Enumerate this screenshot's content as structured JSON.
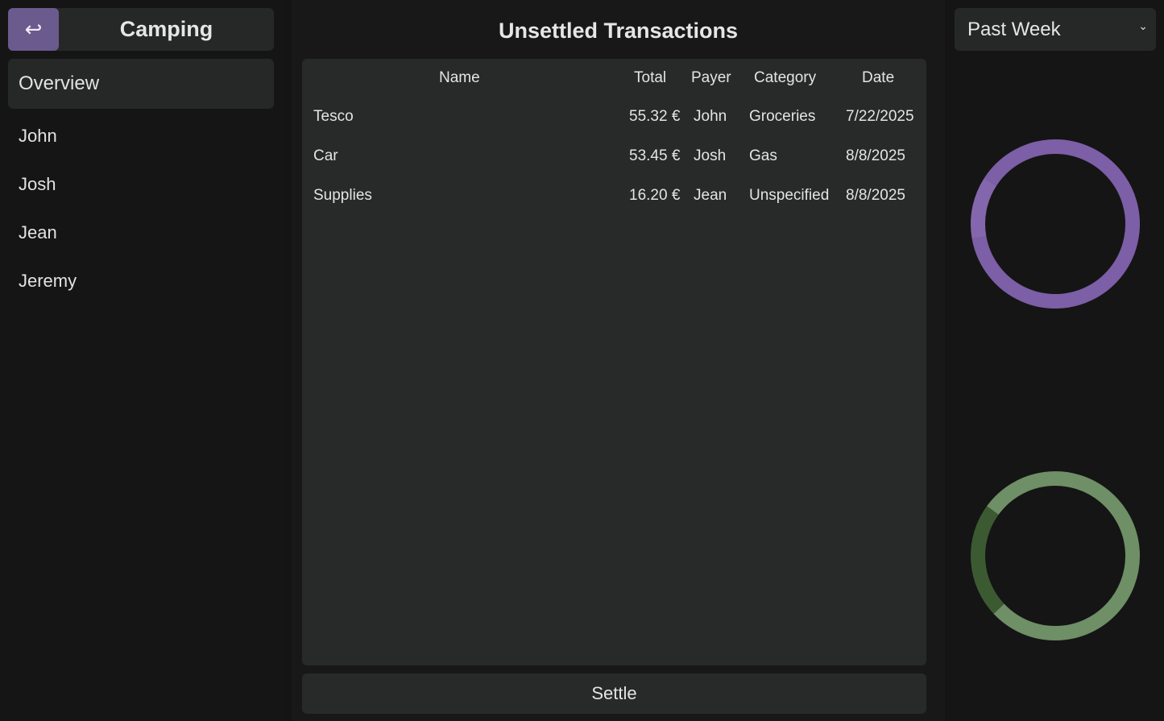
{
  "group": {
    "title": "Camping",
    "back_icon": "↩"
  },
  "sidebar": {
    "items": [
      {
        "label": "Overview",
        "active": true
      },
      {
        "label": "John"
      },
      {
        "label": "Josh"
      },
      {
        "label": "Jean"
      },
      {
        "label": "Jeremy"
      }
    ]
  },
  "main": {
    "title": "Unsettled Transactions",
    "columns": {
      "name": "Name",
      "total": "Total",
      "payer": "Payer",
      "category": "Category",
      "date": "Date"
    },
    "rows": [
      {
        "name": "Tesco",
        "total": "55.32 €",
        "payer": "John",
        "category": "Groceries",
        "date": "7/22/2025"
      },
      {
        "name": "Car",
        "total": "53.45 €",
        "payer": "Josh",
        "category": "Gas",
        "date": "8/8/2025"
      },
      {
        "name": "Supplies",
        "total": "16.20 €",
        "payer": "Jean",
        "category": "Unspecified",
        "date": "8/8/2025"
      }
    ],
    "settle_label": "Settle"
  },
  "filter": {
    "range_label": "Past Week"
  },
  "charts": {
    "colors": {
      "accent": "#6b5a8e",
      "purple": "#7c5fa6",
      "purple_light": "#8466ad",
      "green": "#6f8f66",
      "green_dark": "#3b5a32"
    }
  },
  "chart_data": [
    {
      "type": "pie",
      "categories": [
        "",
        ""
      ],
      "values": [
        0.88,
        0.12
      ]
    },
    {
      "type": "pie",
      "categories": [
        "",
        ""
      ],
      "values": [
        0.78,
        0.22
      ]
    }
  ]
}
